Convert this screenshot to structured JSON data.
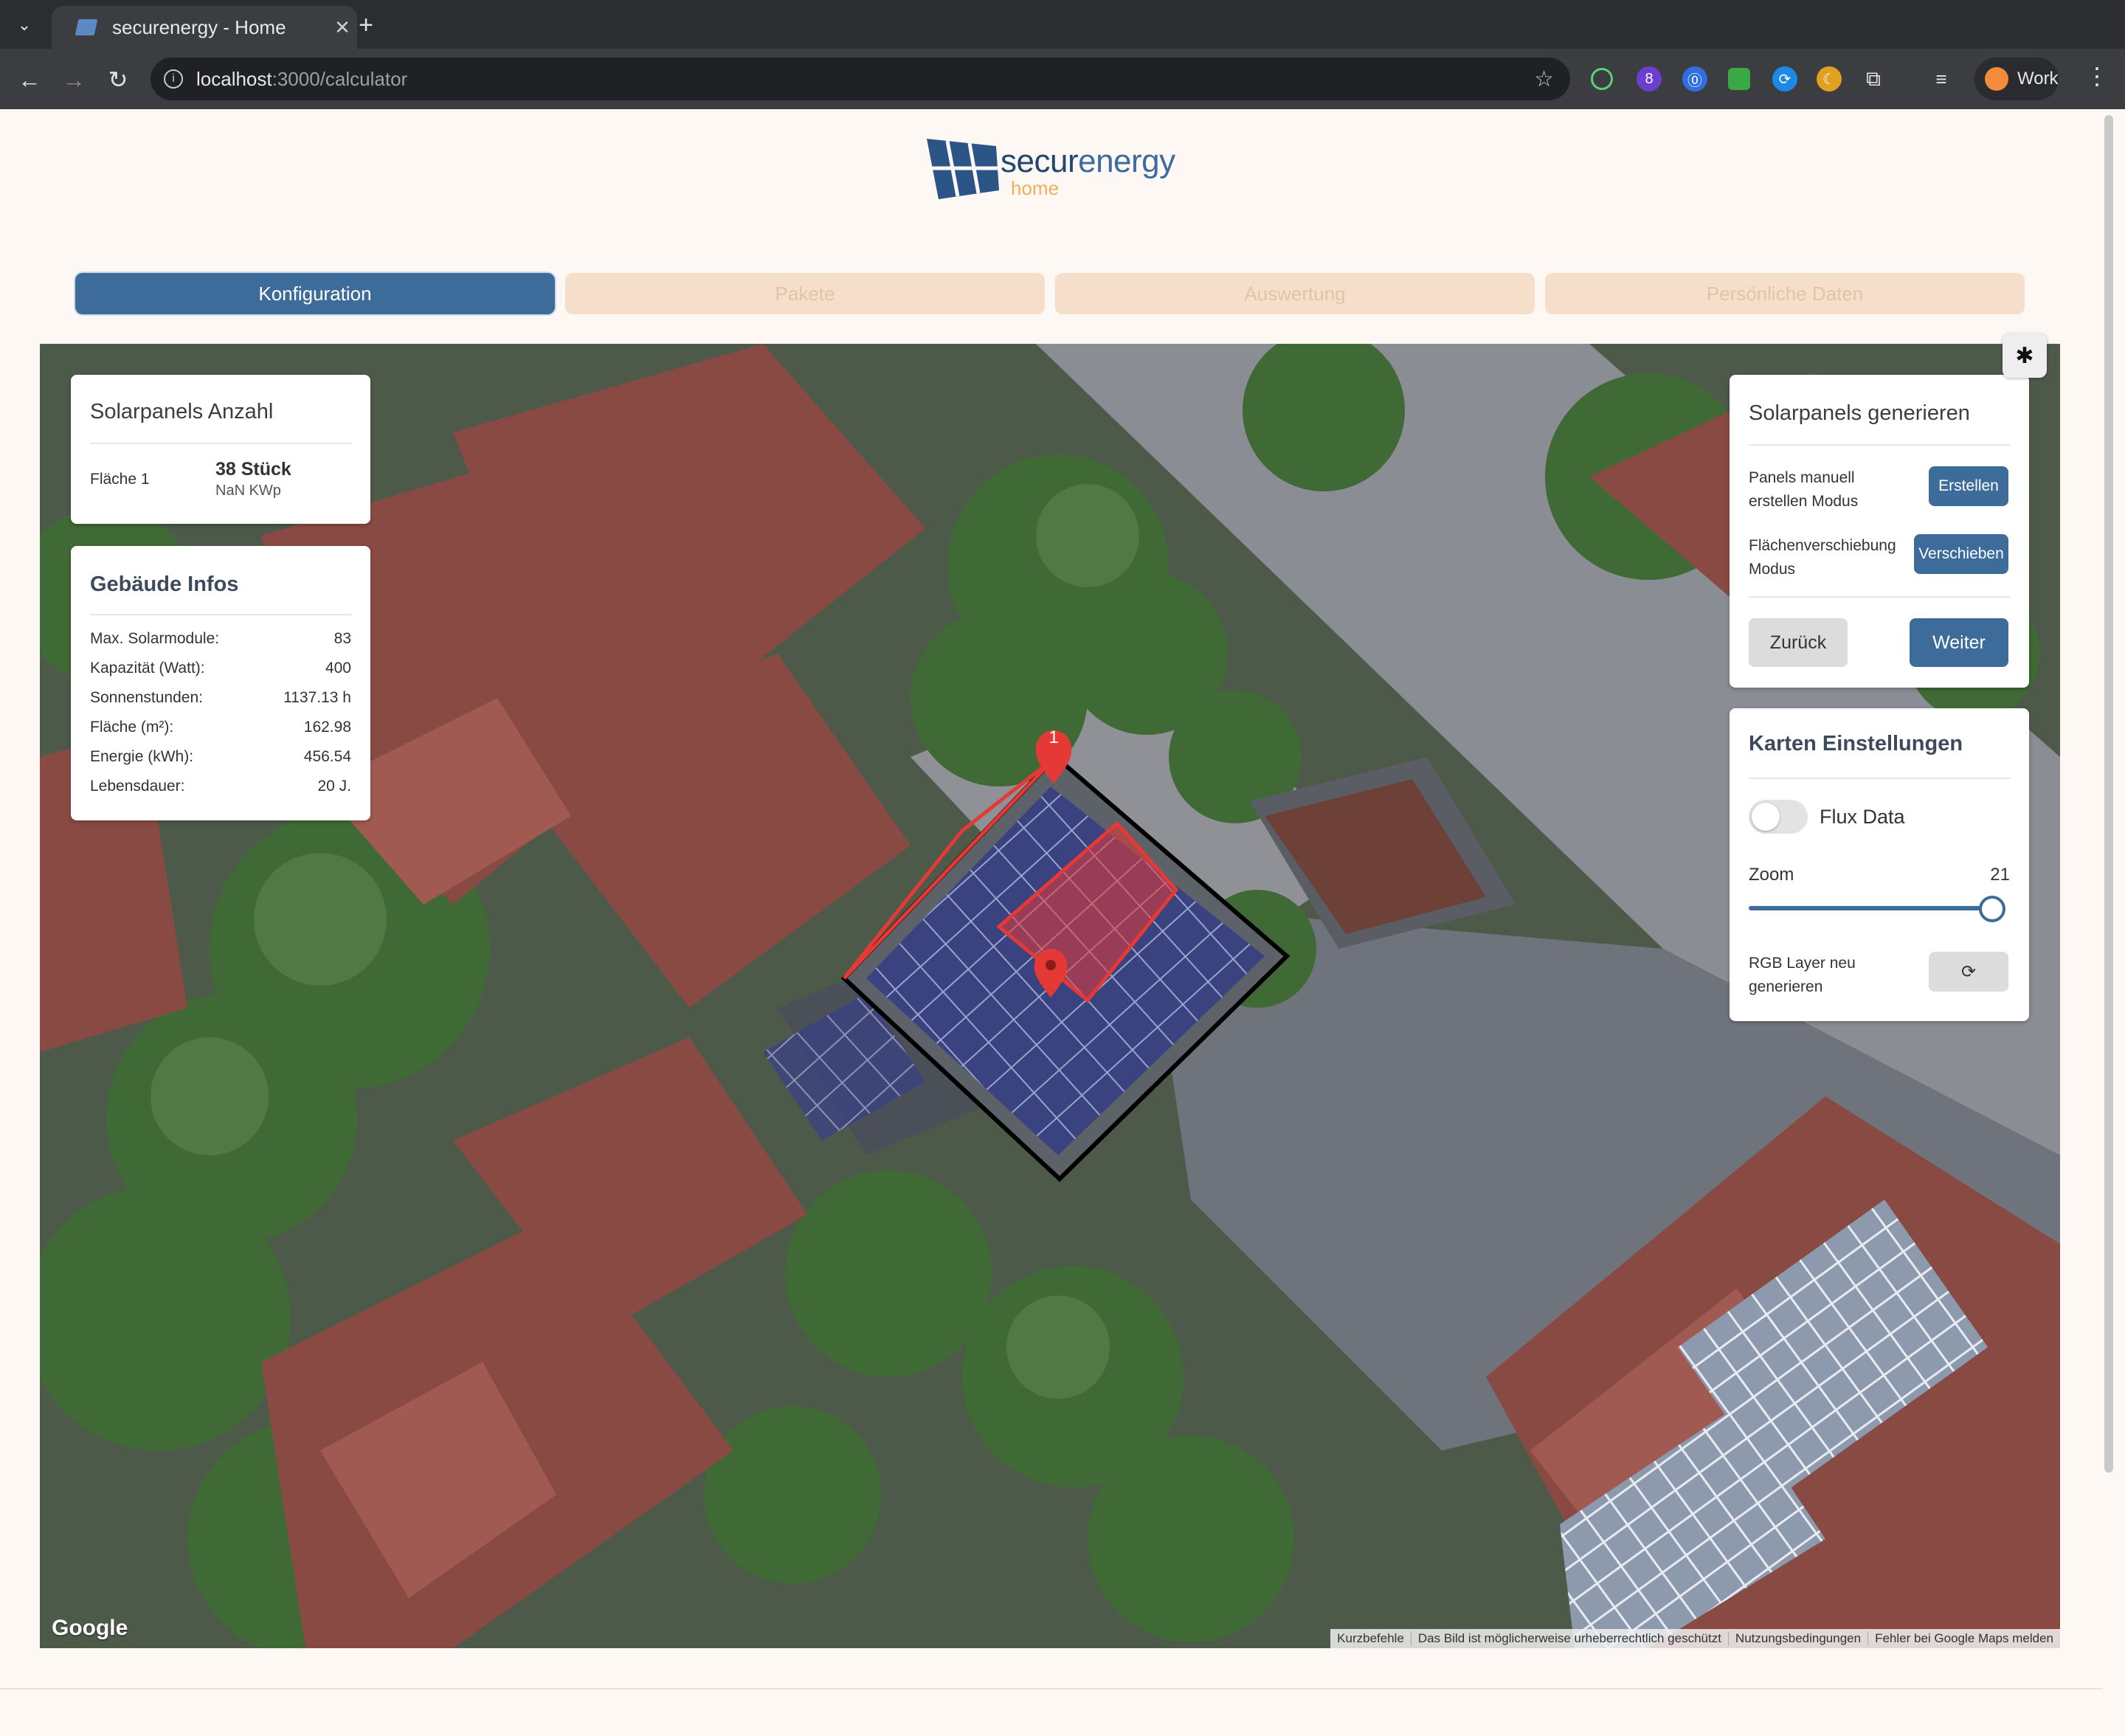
{
  "browser": {
    "tab_title": "securenergy - Home",
    "url_host": "localhost",
    "url_path": ":3000/calculator",
    "extension_badge": "8",
    "profile_label": "Work",
    "icons": [
      "tab-search-icon",
      "close-icon",
      "new-tab-icon",
      "back-icon",
      "forward-icon",
      "reload-icon",
      "site-info-icon",
      "bookmark-star-icon",
      "extensions-icon",
      "media-icon",
      "kebab-menu-icon"
    ]
  },
  "logo": {
    "brand_a": "secur",
    "brand_b": "energy",
    "sub": "home"
  },
  "steps": [
    {
      "label": "Konfiguration",
      "active": true
    },
    {
      "label": "Pakete",
      "active": false
    },
    {
      "label": "Auswertung",
      "active": false
    },
    {
      "label": "Persönliche Daten",
      "active": false
    }
  ],
  "panels_count": {
    "title": "Solarpanels Anzahl",
    "area_label": "Fläche 1",
    "count": "38 Stück",
    "power": "NaN KWp"
  },
  "building": {
    "title": "Gebäude Infos",
    "rows": [
      {
        "label": "Max. Solarmodule:",
        "value": "83"
      },
      {
        "label": "Kapazität (Watt):",
        "value": "400"
      },
      {
        "label": "Sonnenstunden:",
        "value": "1137.13 h"
      },
      {
        "label": "Fläche (m²):",
        "value": "162.98"
      },
      {
        "label": "Energie (kWh):",
        "value": "456.54"
      },
      {
        "label": "Lebensdauer:",
        "value": "20 J."
      }
    ]
  },
  "generate": {
    "title": "Solarpanels generieren",
    "manual_label": "Panels manuell erstellen Modus",
    "manual_button": "Erstellen",
    "shift_label": "Flächenverschiebung Modus",
    "shift_button": "Verschieben",
    "back_button": "Zurück",
    "next_button": "Weiter"
  },
  "map_settings": {
    "title": "Karten Einstellungen",
    "flux_label": "Flux Data",
    "flux_on": false,
    "zoom_label": "Zoom",
    "zoom_value": "21",
    "zoom_fraction": 1.0,
    "rgb_label": "RGB Layer neu generieren",
    "rgb_icon": "refresh-icon"
  },
  "map": {
    "marker_label": "1",
    "google": "Google",
    "attribution": [
      "Kurzbefehle",
      "Das Bild ist möglicherweise urheberrechtlich geschützt",
      "Nutzungsbedingungen",
      "Fehler bei Google Maps melden"
    ]
  },
  "colors": {
    "primary": "#3d6c9b",
    "step_inactive": "#f6dfca",
    "marker_red": "#e53935",
    "accent_orange": "#f2b05a"
  }
}
